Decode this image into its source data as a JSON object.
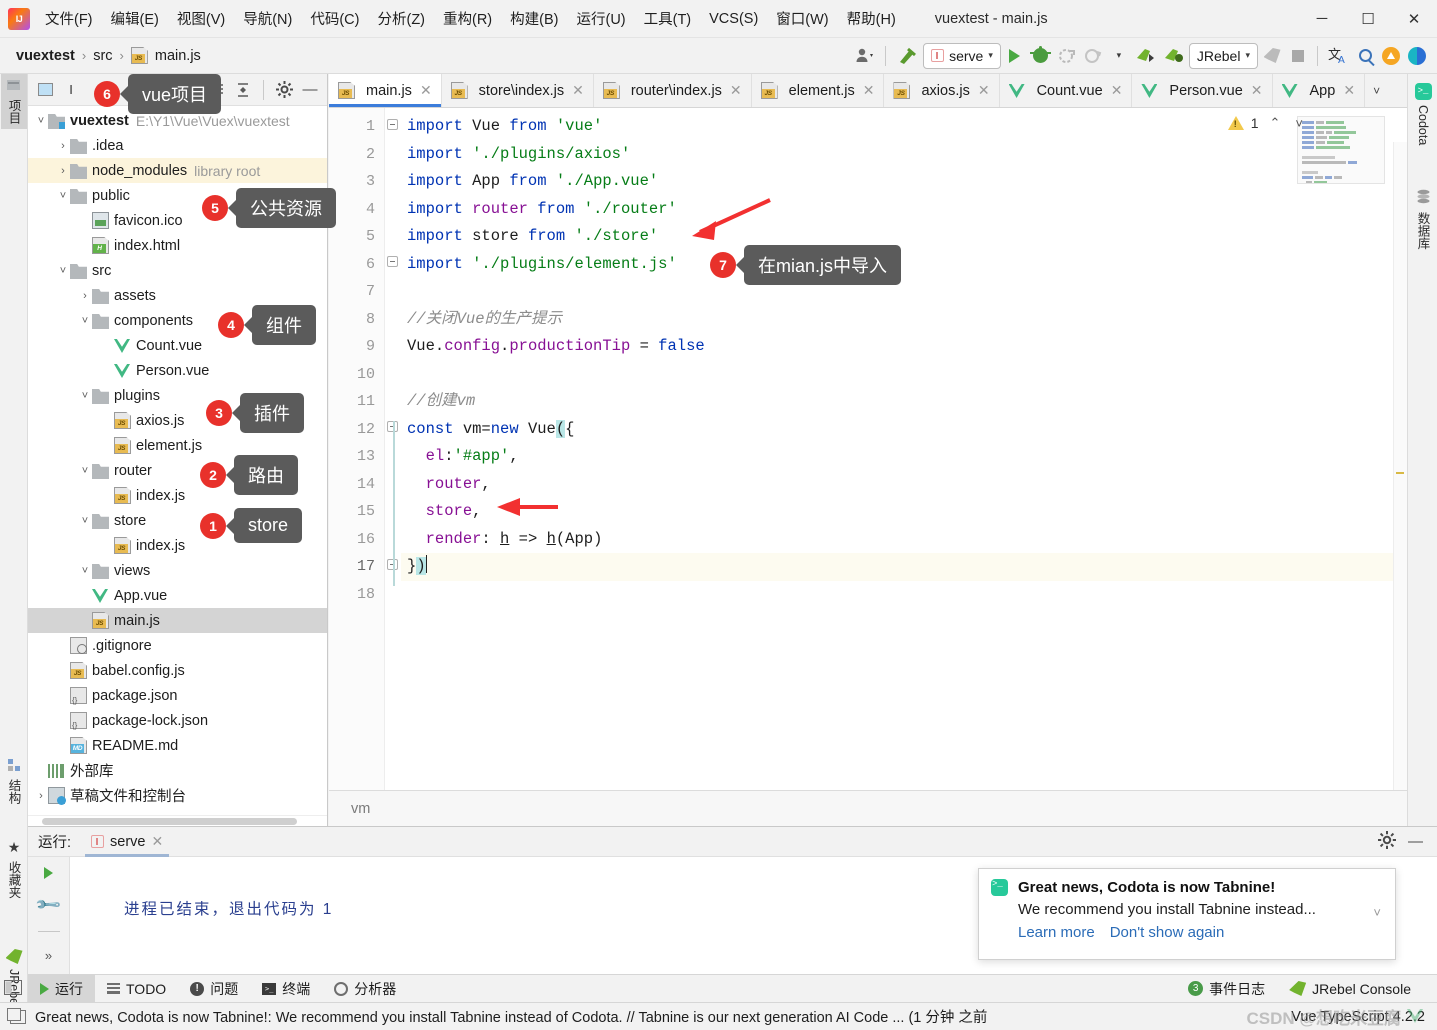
{
  "window": {
    "title": "vuextest - main.js",
    "logo_icon": "intellij-idea-logo",
    "minimize_label": "─",
    "maximize_label": "☐",
    "close_label": "✕"
  },
  "menu": [
    {
      "label": "文件(F)"
    },
    {
      "label": "编辑(E)"
    },
    {
      "label": "视图(V)"
    },
    {
      "label": "导航(N)"
    },
    {
      "label": "代码(C)"
    },
    {
      "label": "分析(Z)"
    },
    {
      "label": "重构(R)"
    },
    {
      "label": "构建(B)"
    },
    {
      "label": "运行(U)"
    },
    {
      "label": "工具(T)"
    },
    {
      "label": "VCS(S)"
    },
    {
      "label": "窗口(W)"
    },
    {
      "label": "帮助(H)"
    }
  ],
  "breadcrumb": {
    "segments": [
      "vuextest",
      "src",
      "main.js"
    ],
    "separator": "›"
  },
  "toolbar": {
    "run_config": "serve",
    "jrebel_label": "JRebel",
    "caret": "▾",
    "icons": [
      "user-avatar-icon",
      "hammer-build-icon",
      "run-icon",
      "debug-icon",
      "run-with-coverage-icon",
      "profile-icon",
      "jrebel-run-icon",
      "jrebel-debug-icon",
      "jrebel-stop-icon",
      "stop-icon",
      "translate-icon",
      "search-everywhere-icon",
      "update-icon",
      "codota-icon"
    ]
  },
  "left_tool_strip": [
    {
      "label": "项目",
      "icon": "project-icon",
      "selected": true
    },
    {
      "label": "结构",
      "icon": "structure-icon",
      "selected": false
    },
    {
      "label": "收藏夹",
      "icon": "favorites-star-icon",
      "selected": false
    },
    {
      "label": "JRebel",
      "icon": "jrebel-leaf-icon",
      "selected": false
    }
  ],
  "right_tool_strip": [
    {
      "label": "Codota",
      "icon": "codota-icon"
    },
    {
      "label": "数据库",
      "icon": "database-icon"
    }
  ],
  "project_panel": {
    "toolbar_icons": [
      "project-scope-icon",
      "collapse-all-icon",
      "expand-all-icon",
      "settings-gear-icon",
      "hide-icon"
    ],
    "tree": [
      {
        "depth": 0,
        "chev": "˅",
        "icon": "folder-module",
        "label": "vuextest",
        "bold": true,
        "sub": "E:\\Y1\\Vue\\Vuex\\vuextest",
        "state": "normal"
      },
      {
        "depth": 1,
        "chev": "›",
        "icon": "folder",
        "label": ".idea",
        "bold": false,
        "sub": "",
        "state": "normal"
      },
      {
        "depth": 1,
        "chev": "›",
        "icon": "folder",
        "label": "node_modules",
        "bold": false,
        "sub": "library root",
        "state": "hl"
      },
      {
        "depth": 1,
        "chev": "˅",
        "icon": "folder",
        "label": "public",
        "bold": false,
        "sub": "",
        "state": "normal"
      },
      {
        "depth": 2,
        "chev": "",
        "icon": "file-img",
        "label": "favicon.ico",
        "bold": false,
        "sub": "",
        "state": "normal"
      },
      {
        "depth": 2,
        "chev": "",
        "icon": "file-html",
        "label": "index.html",
        "bold": false,
        "sub": "",
        "state": "normal"
      },
      {
        "depth": 1,
        "chev": "˅",
        "icon": "folder",
        "label": "src",
        "bold": false,
        "sub": "",
        "state": "normal"
      },
      {
        "depth": 2,
        "chev": "›",
        "icon": "folder",
        "label": "assets",
        "bold": false,
        "sub": "",
        "state": "normal"
      },
      {
        "depth": 2,
        "chev": "˅",
        "icon": "folder",
        "label": "components",
        "bold": false,
        "sub": "",
        "state": "normal"
      },
      {
        "depth": 3,
        "chev": "",
        "icon": "file-vue",
        "label": "Count.vue",
        "bold": false,
        "sub": "",
        "state": "normal"
      },
      {
        "depth": 3,
        "chev": "",
        "icon": "file-vue",
        "label": "Person.vue",
        "bold": false,
        "sub": "",
        "state": "normal"
      },
      {
        "depth": 2,
        "chev": "˅",
        "icon": "folder",
        "label": "plugins",
        "bold": false,
        "sub": "",
        "state": "normal"
      },
      {
        "depth": 3,
        "chev": "",
        "icon": "file-js",
        "label": "axios.js",
        "bold": false,
        "sub": "",
        "state": "normal"
      },
      {
        "depth": 3,
        "chev": "",
        "icon": "file-js",
        "label": "element.js",
        "bold": false,
        "sub": "",
        "state": "normal"
      },
      {
        "depth": 2,
        "chev": "˅",
        "icon": "folder",
        "label": "router",
        "bold": false,
        "sub": "",
        "state": "normal"
      },
      {
        "depth": 3,
        "chev": "",
        "icon": "file-js",
        "label": "index.js",
        "bold": false,
        "sub": "",
        "state": "normal"
      },
      {
        "depth": 2,
        "chev": "˅",
        "icon": "folder",
        "label": "store",
        "bold": false,
        "sub": "",
        "state": "normal"
      },
      {
        "depth": 3,
        "chev": "",
        "icon": "file-js",
        "label": "index.js",
        "bold": false,
        "sub": "",
        "state": "normal"
      },
      {
        "depth": 2,
        "chev": "˅",
        "icon": "folder",
        "label": "views",
        "bold": false,
        "sub": "",
        "state": "normal"
      },
      {
        "depth": 2,
        "chev": "",
        "icon": "file-vue",
        "label": "App.vue",
        "bold": false,
        "sub": "",
        "state": "normal"
      },
      {
        "depth": 2,
        "chev": "",
        "icon": "file-js",
        "label": "main.js",
        "bold": false,
        "sub": "",
        "state": "sel"
      },
      {
        "depth": 1,
        "chev": "",
        "icon": "file-gitignore",
        "label": ".gitignore",
        "bold": false,
        "sub": "",
        "state": "normal"
      },
      {
        "depth": 1,
        "chev": "",
        "icon": "file-js",
        "label": "babel.config.js",
        "bold": false,
        "sub": "",
        "state": "normal"
      },
      {
        "depth": 1,
        "chev": "",
        "icon": "file-json",
        "label": "package.json",
        "bold": false,
        "sub": "",
        "state": "normal"
      },
      {
        "depth": 1,
        "chev": "",
        "icon": "file-json",
        "label": "package-lock.json",
        "bold": false,
        "sub": "",
        "state": "normal"
      },
      {
        "depth": 1,
        "chev": "",
        "icon": "file-md",
        "label": "README.md",
        "bold": false,
        "sub": "",
        "state": "normal"
      },
      {
        "depth": 0,
        "chev": "",
        "icon": "lib-icon",
        "label": "外部库",
        "bold": false,
        "sub": "",
        "state": "normal"
      },
      {
        "depth": 0,
        "chev": "›",
        "icon": "scratch-icon",
        "label": "草稿文件和控制台",
        "bold": false,
        "sub": "",
        "state": "normal"
      }
    ]
  },
  "callouts": [
    {
      "num": "6",
      "text": "vue项目"
    },
    {
      "num": "5",
      "text": "公共资源"
    },
    {
      "num": "4",
      "text": "组件"
    },
    {
      "num": "3",
      "text": "插件"
    },
    {
      "num": "2",
      "text": "路由"
    },
    {
      "num": "1",
      "text": "store"
    },
    {
      "num": "7",
      "text": "在mian.js中导入"
    }
  ],
  "editor": {
    "tabs": [
      {
        "label": "main.js",
        "icon": "file-js",
        "active": true
      },
      {
        "label": "store\\index.js",
        "icon": "file-js",
        "active": false
      },
      {
        "label": "router\\index.js",
        "icon": "file-js",
        "active": false
      },
      {
        "label": "element.js",
        "icon": "file-js",
        "active": false
      },
      {
        "label": "axios.js",
        "icon": "file-js",
        "active": false
      },
      {
        "label": "Count.vue",
        "icon": "file-vue",
        "active": false
      },
      {
        "label": "Person.vue",
        "icon": "file-vue",
        "active": false
      },
      {
        "label": "App",
        "icon": "file-vue",
        "active": false
      }
    ],
    "tab_close_label": "✕",
    "tab_overflow_label": "˅",
    "warning_count": "1",
    "warning_up": "⌃",
    "warning_down": "˅",
    "line_numbers": [
      "1",
      "2",
      "3",
      "4",
      "5",
      "6",
      "7",
      "8",
      "9",
      "10",
      "11",
      "12",
      "13",
      "14",
      "15",
      "16",
      "17",
      "18"
    ],
    "code_lines": [
      {
        "n": 1,
        "tokens": [
          {
            "t": "import",
            "c": "kw"
          },
          {
            "t": " Vue ",
            "c": "id"
          },
          {
            "t": "from",
            "c": "kw"
          },
          {
            "t": " ",
            "c": "id"
          },
          {
            "t": "'vue'",
            "c": "str"
          }
        ]
      },
      {
        "n": 2,
        "tokens": [
          {
            "t": "import",
            "c": "kw"
          },
          {
            "t": " ",
            "c": "id"
          },
          {
            "t": "'./plugins/axios'",
            "c": "str"
          }
        ]
      },
      {
        "n": 3,
        "tokens": [
          {
            "t": "import",
            "c": "kw"
          },
          {
            "t": " App ",
            "c": "id"
          },
          {
            "t": "from",
            "c": "kw"
          },
          {
            "t": " ",
            "c": "id"
          },
          {
            "t": "'./App.vue'",
            "c": "str"
          }
        ]
      },
      {
        "n": 4,
        "tokens": [
          {
            "t": "import",
            "c": "kw"
          },
          {
            "t": " ",
            "c": "id"
          },
          {
            "t": "router",
            "c": "prop"
          },
          {
            "t": " ",
            "c": "id"
          },
          {
            "t": "from",
            "c": "kw"
          },
          {
            "t": " ",
            "c": "id"
          },
          {
            "t": "'./router'",
            "c": "str"
          }
        ]
      },
      {
        "n": 5,
        "tokens": [
          {
            "t": "import",
            "c": "kw"
          },
          {
            "t": " store ",
            "c": "id"
          },
          {
            "t": "from",
            "c": "kw"
          },
          {
            "t": " ",
            "c": "id"
          },
          {
            "t": "'./store'",
            "c": "str"
          }
        ]
      },
      {
        "n": 6,
        "tokens": [
          {
            "t": "import",
            "c": "kw"
          },
          {
            "t": " ",
            "c": "id"
          },
          {
            "t": "'./plugins/element.js'",
            "c": "str"
          }
        ]
      },
      {
        "n": 7,
        "tokens": []
      },
      {
        "n": 8,
        "tokens": [
          {
            "t": "//关闭Vue的生产提示",
            "c": "com"
          }
        ]
      },
      {
        "n": 9,
        "tokens": [
          {
            "t": "Vue",
            "c": "id"
          },
          {
            "t": ".",
            "c": "id"
          },
          {
            "t": "config",
            "c": "prop"
          },
          {
            "t": ".",
            "c": "id"
          },
          {
            "t": "productionTip",
            "c": "prop"
          },
          {
            "t": " = ",
            "c": "id"
          },
          {
            "t": "false",
            "c": "kw"
          }
        ]
      },
      {
        "n": 10,
        "tokens": []
      },
      {
        "n": 11,
        "tokens": [
          {
            "t": "//创建vm",
            "c": "com"
          }
        ]
      },
      {
        "n": 12,
        "tokens": [
          {
            "t": "const",
            "c": "kw"
          },
          {
            "t": " vm=",
            "c": "id"
          },
          {
            "t": "new",
            "c": "kw"
          },
          {
            "t": " Vue",
            "c": "id"
          },
          {
            "t": "(",
            "c": "bracehl"
          },
          {
            "t": "{",
            "c": "id"
          }
        ]
      },
      {
        "n": 13,
        "tokens": [
          {
            "t": "  ",
            "c": "id"
          },
          {
            "t": "el",
            "c": "prop"
          },
          {
            "t": ":",
            "c": "id"
          },
          {
            "t": "'#app'",
            "c": "str"
          },
          {
            "t": ",",
            "c": "id"
          }
        ]
      },
      {
        "n": 14,
        "tokens": [
          {
            "t": "  ",
            "c": "id"
          },
          {
            "t": "router",
            "c": "prop"
          },
          {
            "t": ",",
            "c": "id"
          }
        ]
      },
      {
        "n": 15,
        "tokens": [
          {
            "t": "  ",
            "c": "id"
          },
          {
            "t": "store",
            "c": "prop"
          },
          {
            "t": ",",
            "c": "id"
          }
        ]
      },
      {
        "n": 16,
        "tokens": [
          {
            "t": "  ",
            "c": "id"
          },
          {
            "t": "render",
            "c": "prop"
          },
          {
            "t": ": ",
            "c": "id"
          },
          {
            "t": "h",
            "c": "fn"
          },
          {
            "t": " => ",
            "c": "id"
          },
          {
            "t": "h",
            "c": "fn"
          },
          {
            "t": "(App)",
            "c": "id"
          }
        ]
      },
      {
        "n": 17,
        "tokens": [
          {
            "t": "}",
            "c": "id"
          },
          {
            "t": ")",
            "c": "bracehl"
          }
        ]
      },
      {
        "n": 18,
        "tokens": []
      }
    ],
    "breadcrumb_status": "vm"
  },
  "run_panel": {
    "label": "运行:",
    "tab": "serve",
    "tab_close": "✕",
    "console_text": "进程已结束，退出代码为  1",
    "side_icons": [
      "rerun-icon",
      "settings-wrench-icon",
      "more-icon"
    ],
    "more_label": "»",
    "header_icons": [
      "settings-gear-icon",
      "hide-icon"
    ]
  },
  "notification": {
    "icon": "tabnine-icon",
    "title": "Great news, Codota is now Tabnine!",
    "body": "We recommend you install Tabnine instead...",
    "links": [
      "Learn more",
      "Don't show again"
    ],
    "collapse_label": "˅"
  },
  "bottom_bar": {
    "items": [
      {
        "label": "运行",
        "icon": "run-icon",
        "selected": true
      },
      {
        "label": "TODO",
        "icon": "todo-icon",
        "selected": false
      },
      {
        "label": "问题",
        "icon": "problems-icon",
        "selected": false
      },
      {
        "label": "终端",
        "icon": "terminal-icon",
        "selected": false
      },
      {
        "label": "分析器",
        "icon": "profiler-icon",
        "selected": false
      }
    ],
    "right_items": [
      {
        "label": "事件日志",
        "icon": "event-log-icon",
        "badge": "3"
      },
      {
        "label": "JRebel Console",
        "icon": "jrebel-leaf-icon",
        "badge": ""
      }
    ]
  },
  "status_bar": {
    "icon": "notification-icon",
    "message": "Great news, Codota is now Tabnine!: We recommend you install Tabnine instead of Codota. // Tabnine is our next generation AI Code ... (1 分钟 之前",
    "right": [
      "Vue TypeScript 4.2.2"
    ],
    "watermark": "CSDN @想吃米豆腐"
  },
  "colors": {
    "accent_blue": "#3c7ddb",
    "callout_red": "#e8312b",
    "callout_bg": "#5b5b5b",
    "vue_green": "#41b883",
    "keyword_blue": "#0033b3",
    "string_green": "#067d17",
    "prop_purple": "#871094",
    "comment_gray": "#8c8c8c"
  }
}
